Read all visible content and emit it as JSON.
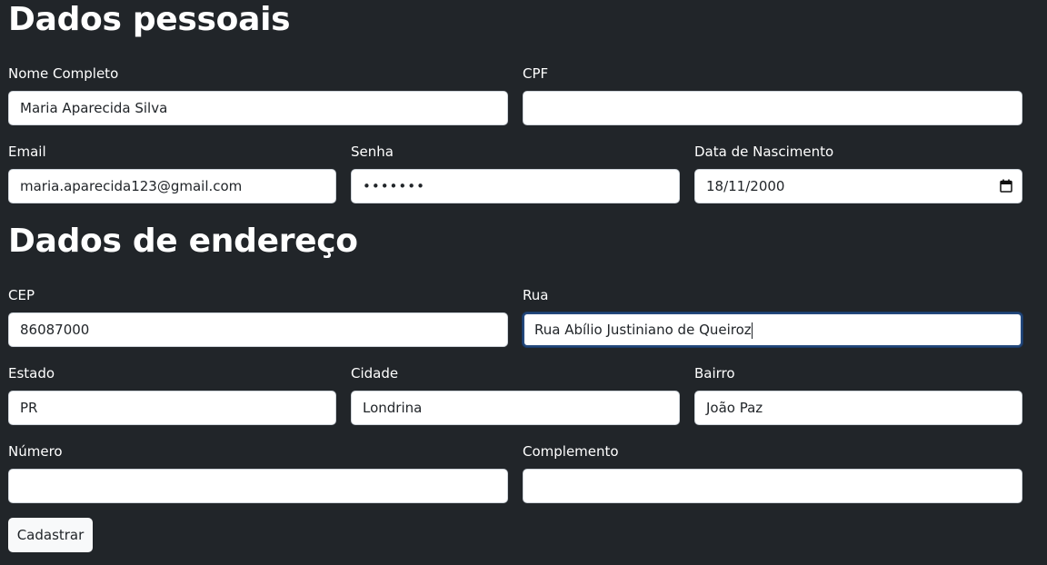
{
  "personal": {
    "heading": "Dados pessoais",
    "nome": {
      "label": "Nome Completo",
      "value": "Maria Aparecida Silva"
    },
    "cpf": {
      "label": "CPF",
      "value": ""
    },
    "email": {
      "label": "Email",
      "value": "maria.aparecida123@gmail.com"
    },
    "senha": {
      "label": "Senha",
      "value": "•••••••"
    },
    "nascimento": {
      "label": "Data de Nascimento",
      "value": "18/11/2000"
    }
  },
  "address": {
    "heading": "Dados de endereço",
    "cep": {
      "label": "CEP",
      "value": "86087000"
    },
    "rua": {
      "label": "Rua",
      "value": "Rua Abílio Justiniano de Queiroz"
    },
    "estado": {
      "label": "Estado",
      "value": "PR"
    },
    "cidade": {
      "label": "Cidade",
      "value": "Londrina"
    },
    "bairro": {
      "label": "Bairro",
      "value": "João Paz"
    },
    "numero": {
      "label": "Número",
      "value": ""
    },
    "complemento": {
      "label": "Complemento",
      "value": ""
    }
  },
  "actions": {
    "submit_label": "Cadastrar"
  },
  "icons": {
    "date_picker": "calendar-icon"
  },
  "colors": {
    "background": "#212529",
    "input_background": "#ffffff",
    "input_border": "#ced4da",
    "focus_border": "#23487c",
    "button_background": "#f8f9fa"
  }
}
